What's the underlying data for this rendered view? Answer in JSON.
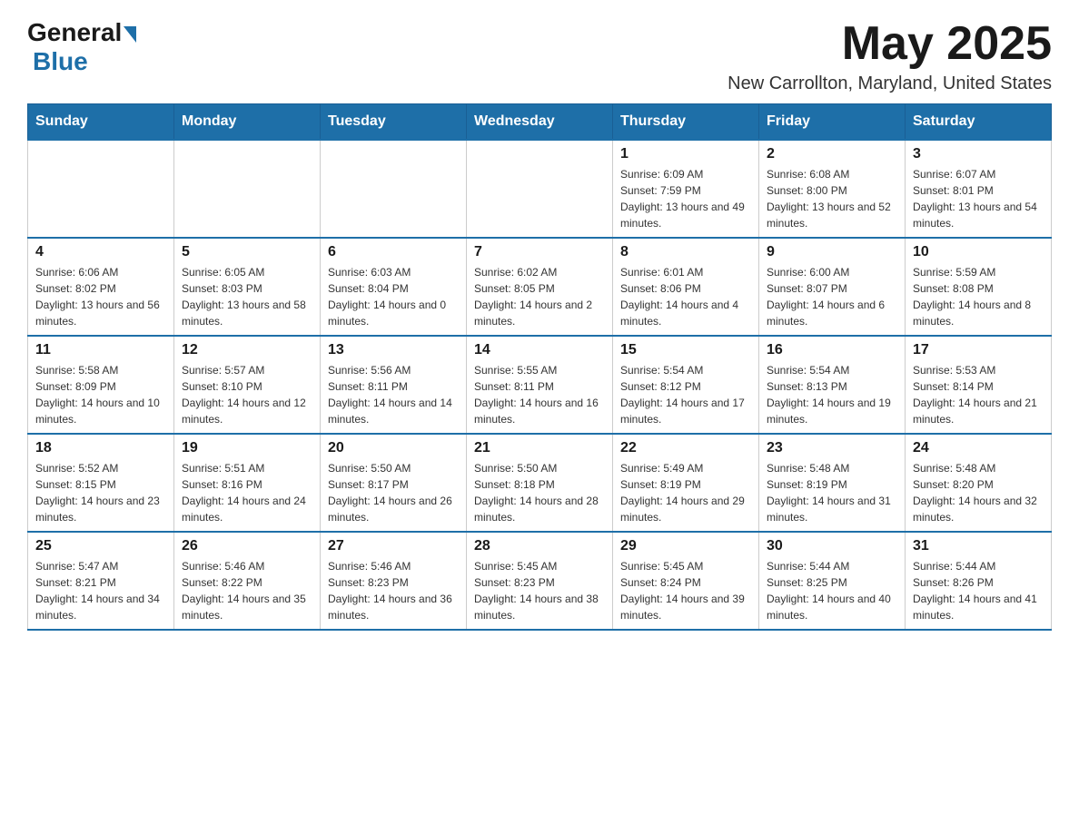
{
  "header": {
    "logo_general": "General",
    "logo_blue": "Blue",
    "month_title": "May 2025",
    "location": "New Carrollton, Maryland, United States"
  },
  "weekdays": [
    "Sunday",
    "Monday",
    "Tuesday",
    "Wednesday",
    "Thursday",
    "Friday",
    "Saturday"
  ],
  "weeks": [
    [
      {
        "day": "",
        "info": ""
      },
      {
        "day": "",
        "info": ""
      },
      {
        "day": "",
        "info": ""
      },
      {
        "day": "",
        "info": ""
      },
      {
        "day": "1",
        "info": "Sunrise: 6:09 AM\nSunset: 7:59 PM\nDaylight: 13 hours and 49 minutes."
      },
      {
        "day": "2",
        "info": "Sunrise: 6:08 AM\nSunset: 8:00 PM\nDaylight: 13 hours and 52 minutes."
      },
      {
        "day": "3",
        "info": "Sunrise: 6:07 AM\nSunset: 8:01 PM\nDaylight: 13 hours and 54 minutes."
      }
    ],
    [
      {
        "day": "4",
        "info": "Sunrise: 6:06 AM\nSunset: 8:02 PM\nDaylight: 13 hours and 56 minutes."
      },
      {
        "day": "5",
        "info": "Sunrise: 6:05 AM\nSunset: 8:03 PM\nDaylight: 13 hours and 58 minutes."
      },
      {
        "day": "6",
        "info": "Sunrise: 6:03 AM\nSunset: 8:04 PM\nDaylight: 14 hours and 0 minutes."
      },
      {
        "day": "7",
        "info": "Sunrise: 6:02 AM\nSunset: 8:05 PM\nDaylight: 14 hours and 2 minutes."
      },
      {
        "day": "8",
        "info": "Sunrise: 6:01 AM\nSunset: 8:06 PM\nDaylight: 14 hours and 4 minutes."
      },
      {
        "day": "9",
        "info": "Sunrise: 6:00 AM\nSunset: 8:07 PM\nDaylight: 14 hours and 6 minutes."
      },
      {
        "day": "10",
        "info": "Sunrise: 5:59 AM\nSunset: 8:08 PM\nDaylight: 14 hours and 8 minutes."
      }
    ],
    [
      {
        "day": "11",
        "info": "Sunrise: 5:58 AM\nSunset: 8:09 PM\nDaylight: 14 hours and 10 minutes."
      },
      {
        "day": "12",
        "info": "Sunrise: 5:57 AM\nSunset: 8:10 PM\nDaylight: 14 hours and 12 minutes."
      },
      {
        "day": "13",
        "info": "Sunrise: 5:56 AM\nSunset: 8:11 PM\nDaylight: 14 hours and 14 minutes."
      },
      {
        "day": "14",
        "info": "Sunrise: 5:55 AM\nSunset: 8:11 PM\nDaylight: 14 hours and 16 minutes."
      },
      {
        "day": "15",
        "info": "Sunrise: 5:54 AM\nSunset: 8:12 PM\nDaylight: 14 hours and 17 minutes."
      },
      {
        "day": "16",
        "info": "Sunrise: 5:54 AM\nSunset: 8:13 PM\nDaylight: 14 hours and 19 minutes."
      },
      {
        "day": "17",
        "info": "Sunrise: 5:53 AM\nSunset: 8:14 PM\nDaylight: 14 hours and 21 minutes."
      }
    ],
    [
      {
        "day": "18",
        "info": "Sunrise: 5:52 AM\nSunset: 8:15 PM\nDaylight: 14 hours and 23 minutes."
      },
      {
        "day": "19",
        "info": "Sunrise: 5:51 AM\nSunset: 8:16 PM\nDaylight: 14 hours and 24 minutes."
      },
      {
        "day": "20",
        "info": "Sunrise: 5:50 AM\nSunset: 8:17 PM\nDaylight: 14 hours and 26 minutes."
      },
      {
        "day": "21",
        "info": "Sunrise: 5:50 AM\nSunset: 8:18 PM\nDaylight: 14 hours and 28 minutes."
      },
      {
        "day": "22",
        "info": "Sunrise: 5:49 AM\nSunset: 8:19 PM\nDaylight: 14 hours and 29 minutes."
      },
      {
        "day": "23",
        "info": "Sunrise: 5:48 AM\nSunset: 8:19 PM\nDaylight: 14 hours and 31 minutes."
      },
      {
        "day": "24",
        "info": "Sunrise: 5:48 AM\nSunset: 8:20 PM\nDaylight: 14 hours and 32 minutes."
      }
    ],
    [
      {
        "day": "25",
        "info": "Sunrise: 5:47 AM\nSunset: 8:21 PM\nDaylight: 14 hours and 34 minutes."
      },
      {
        "day": "26",
        "info": "Sunrise: 5:46 AM\nSunset: 8:22 PM\nDaylight: 14 hours and 35 minutes."
      },
      {
        "day": "27",
        "info": "Sunrise: 5:46 AM\nSunset: 8:23 PM\nDaylight: 14 hours and 36 minutes."
      },
      {
        "day": "28",
        "info": "Sunrise: 5:45 AM\nSunset: 8:23 PM\nDaylight: 14 hours and 38 minutes."
      },
      {
        "day": "29",
        "info": "Sunrise: 5:45 AM\nSunset: 8:24 PM\nDaylight: 14 hours and 39 minutes."
      },
      {
        "day": "30",
        "info": "Sunrise: 5:44 AM\nSunset: 8:25 PM\nDaylight: 14 hours and 40 minutes."
      },
      {
        "day": "31",
        "info": "Sunrise: 5:44 AM\nSunset: 8:26 PM\nDaylight: 14 hours and 41 minutes."
      }
    ]
  ],
  "colors": {
    "header_bg": "#1e6fa8",
    "header_text": "#ffffff",
    "border": "#cccccc",
    "accent": "#1e6fa8"
  }
}
